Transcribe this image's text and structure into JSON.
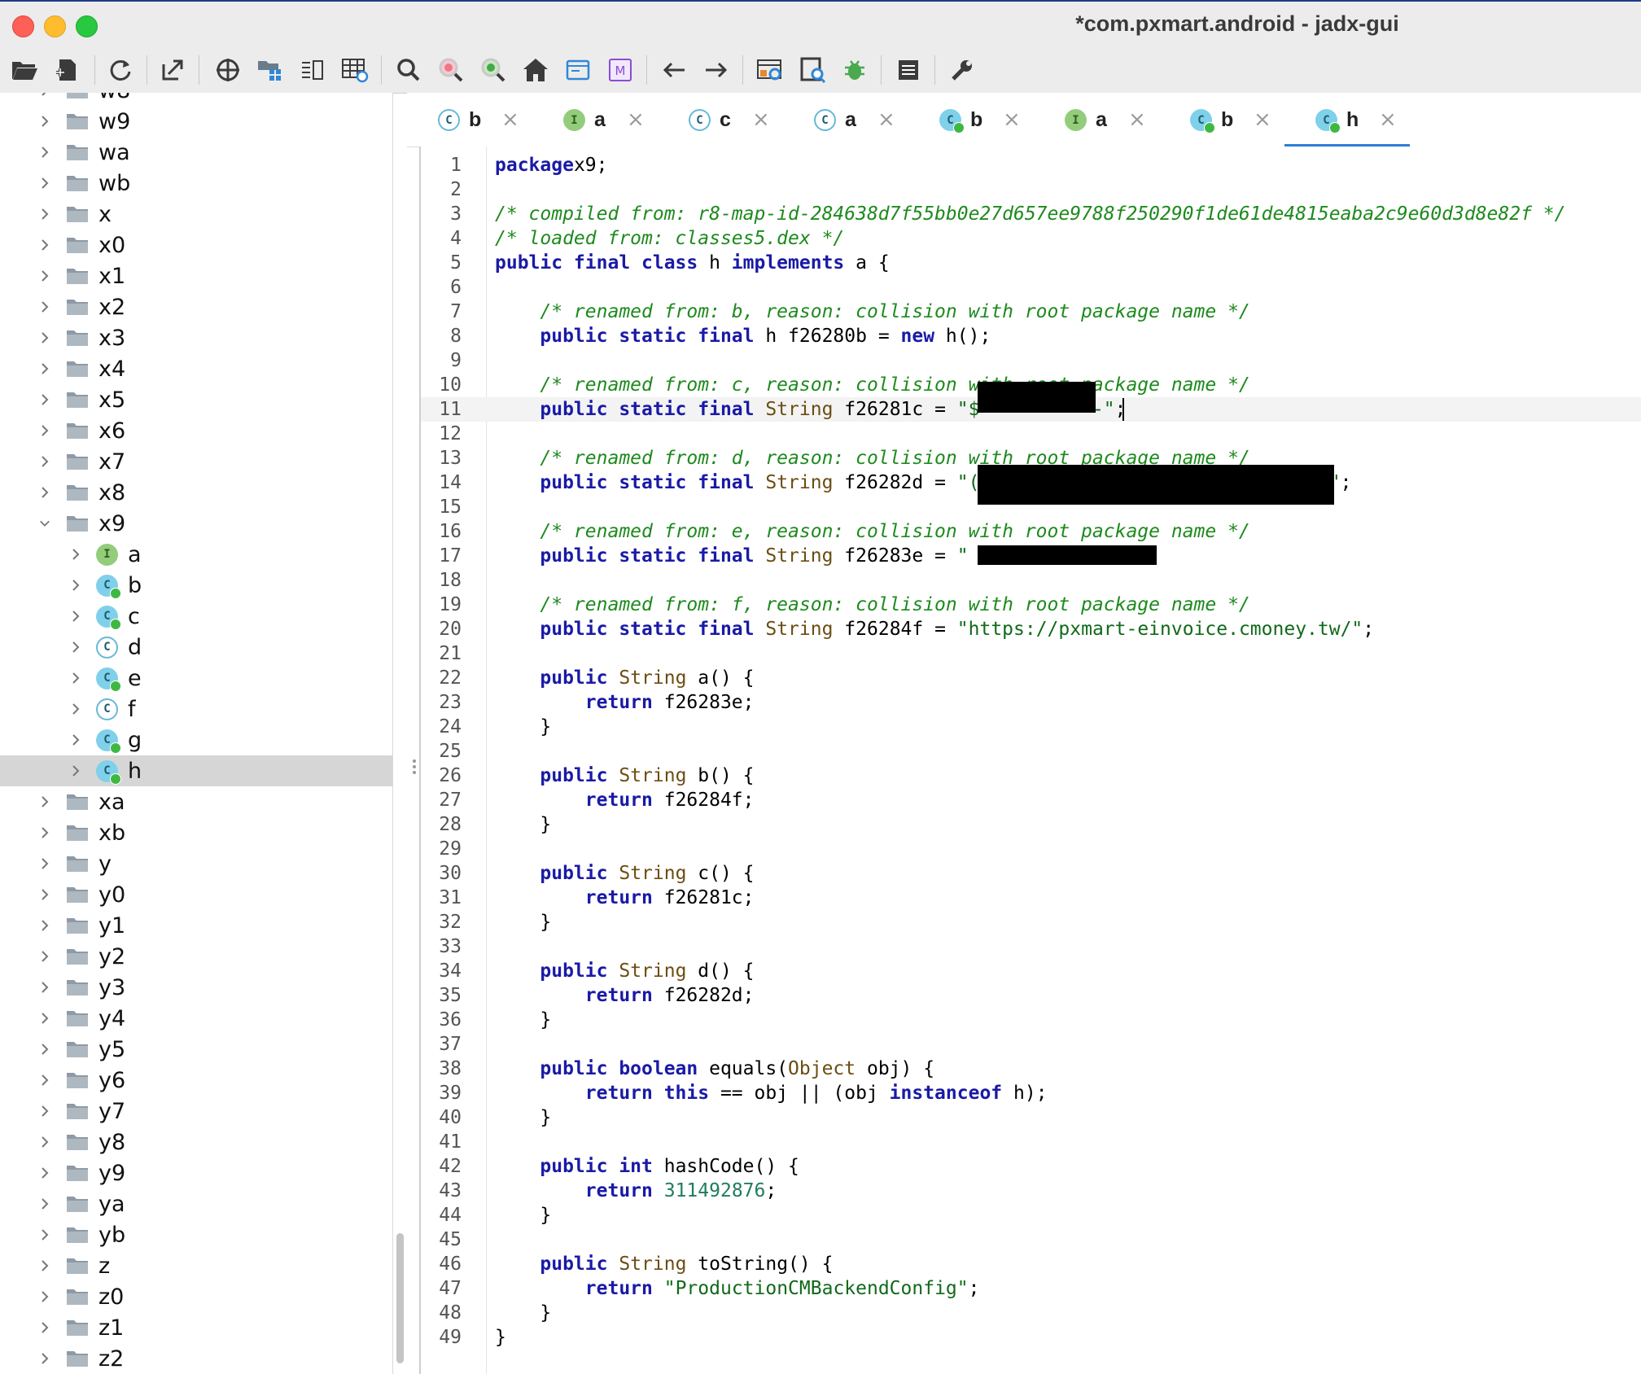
{
  "window": {
    "title": "*com.pxmart.android - jadx-gui"
  },
  "toolbar": {
    "buttons": [
      "open-file-icon",
      "add-files-icon",
      "reload-icon",
      "export-icon",
      "sync-icon",
      "flatten-packages-icon",
      "show-hierarchy-icon",
      "preferences-table-icon",
      "search-icon",
      "text-search-icon",
      "class-search-icon",
      "home-icon",
      "show-log-icon",
      "smali-icon",
      "back-icon",
      "forward-icon",
      "deobfuscation-icon",
      "quark-icon",
      "debug-icon",
      "log-viewer-icon",
      "settings-icon"
    ]
  },
  "tree": {
    "items": [
      {
        "label": "w8",
        "type": "package",
        "expanded": false
      },
      {
        "label": "w9",
        "type": "package",
        "expanded": false
      },
      {
        "label": "wa",
        "type": "package",
        "expanded": false
      },
      {
        "label": "wb",
        "type": "package",
        "expanded": false
      },
      {
        "label": "x",
        "type": "package",
        "expanded": false
      },
      {
        "label": "x0",
        "type": "package",
        "expanded": false
      },
      {
        "label": "x1",
        "type": "package",
        "expanded": false
      },
      {
        "label": "x2",
        "type": "package",
        "expanded": false
      },
      {
        "label": "x3",
        "type": "package",
        "expanded": false
      },
      {
        "label": "x4",
        "type": "package",
        "expanded": false
      },
      {
        "label": "x5",
        "type": "package",
        "expanded": false
      },
      {
        "label": "x6",
        "type": "package",
        "expanded": false
      },
      {
        "label": "x7",
        "type": "package",
        "expanded": false
      },
      {
        "label": "x8",
        "type": "package",
        "expanded": false
      },
      {
        "label": "x9",
        "type": "package",
        "expanded": true
      },
      {
        "label": "a",
        "type": "interface",
        "child": true
      },
      {
        "label": "b",
        "type": "class-public",
        "child": true
      },
      {
        "label": "c",
        "type": "class-public",
        "child": true
      },
      {
        "label": "d",
        "type": "class",
        "child": true
      },
      {
        "label": "e",
        "type": "class-public",
        "child": true
      },
      {
        "label": "f",
        "type": "class",
        "child": true
      },
      {
        "label": "g",
        "type": "class-public",
        "child": true
      },
      {
        "label": "h",
        "type": "class-public",
        "child": true,
        "selected": true
      },
      {
        "label": "xa",
        "type": "package",
        "expanded": false
      },
      {
        "label": "xb",
        "type": "package",
        "expanded": false
      },
      {
        "label": "y",
        "type": "package",
        "expanded": false
      },
      {
        "label": "y0",
        "type": "package",
        "expanded": false
      },
      {
        "label": "y1",
        "type": "package",
        "expanded": false
      },
      {
        "label": "y2",
        "type": "package",
        "expanded": false
      },
      {
        "label": "y3",
        "type": "package",
        "expanded": false
      },
      {
        "label": "y4",
        "type": "package",
        "expanded": false
      },
      {
        "label": "y5",
        "type": "package",
        "expanded": false
      },
      {
        "label": "y6",
        "type": "package",
        "expanded": false
      },
      {
        "label": "y7",
        "type": "package",
        "expanded": false
      },
      {
        "label": "y8",
        "type": "package",
        "expanded": false
      },
      {
        "label": "y9",
        "type": "package",
        "expanded": false
      },
      {
        "label": "ya",
        "type": "package",
        "expanded": false
      },
      {
        "label": "yb",
        "type": "package",
        "expanded": false
      },
      {
        "label": "z",
        "type": "package",
        "expanded": false
      },
      {
        "label": "z0",
        "type": "package",
        "expanded": false
      },
      {
        "label": "z1",
        "type": "package",
        "expanded": false
      },
      {
        "label": "z2",
        "type": "package",
        "expanded": false
      }
    ]
  },
  "tabs": [
    {
      "label": "b",
      "type": "class",
      "close": "×"
    },
    {
      "label": "a",
      "type": "interface",
      "close": "×"
    },
    {
      "label": "c",
      "type": "class",
      "close": "×"
    },
    {
      "label": "a",
      "type": "class",
      "close": "×"
    },
    {
      "label": "b",
      "type": "class-public",
      "close": "×"
    },
    {
      "label": "a",
      "type": "interface",
      "close": "×"
    },
    {
      "label": "b",
      "type": "class-public",
      "close": "×"
    },
    {
      "label": "h",
      "type": "class-public",
      "close": "×",
      "active": true
    }
  ],
  "editor": {
    "current_line": 11,
    "lines": [
      [
        [
          "kw",
          "package"
        ],
        [
          "",
          "x9;"
        ]
      ],
      [],
      [
        [
          "cm",
          "/* compiled from: r8-map-id-284638d7f55bb0e27d657ee9788f250290f1de61de4815eaba2c9e60d3d8e82f */"
        ]
      ],
      [
        [
          "cm",
          "/* loaded from: classes5.dex */"
        ]
      ],
      [
        [
          "kw",
          "public final class"
        ],
        [
          "",
          " h "
        ],
        [
          "kw",
          "implements"
        ],
        [
          "",
          " a {"
        ]
      ],
      [],
      [
        [
          "",
          "    "
        ],
        [
          "cm",
          "/* renamed from: b, reason: collision with root package name */"
        ]
      ],
      [
        [
          "",
          "    "
        ],
        [
          "kw",
          "public static final"
        ],
        [
          "",
          " h f26280b = "
        ],
        [
          "kw",
          "new"
        ],
        [
          "",
          " h();"
        ]
      ],
      [],
      [
        [
          "",
          "    "
        ],
        [
          "cm",
          "/* renamed from: c, reason: collision with root package name */"
        ]
      ],
      [
        [
          "",
          "    "
        ],
        [
          "kw",
          "public static final"
        ],
        [
          "",
          " "
        ],
        [
          "ty",
          "String"
        ],
        [
          "",
          " f26281c = "
        ],
        [
          "st",
          "\"$          -\""
        ],
        [
          "",
          ";"
        ]
      ],
      [],
      [
        [
          "",
          "    "
        ],
        [
          "cm",
          "/* renamed from: d, reason: collision with root package name */"
        ]
      ],
      [
        [
          "",
          "    "
        ],
        [
          "kw",
          "public static final"
        ],
        [
          "",
          " "
        ],
        [
          "ty",
          "String"
        ],
        [
          "",
          " f26282d = "
        ],
        [
          "st",
          "\"(                              4\""
        ],
        [
          "",
          ";"
        ]
      ],
      [],
      [
        [
          "",
          "    "
        ],
        [
          "cm",
          "/* renamed from: e, reason: collision with root package name */"
        ]
      ],
      [
        [
          "",
          "    "
        ],
        [
          "kw",
          "public static final"
        ],
        [
          "",
          " "
        ],
        [
          "ty",
          "String"
        ],
        [
          "",
          " f26283e = "
        ],
        [
          "st",
          "\"               \""
        ],
        [
          "",
          ";"
        ]
      ],
      [],
      [
        [
          "",
          "    "
        ],
        [
          "cm",
          "/* renamed from: f, reason: collision with root package name */"
        ]
      ],
      [
        [
          "",
          "    "
        ],
        [
          "kw",
          "public static final"
        ],
        [
          "",
          " "
        ],
        [
          "ty",
          "String"
        ],
        [
          "",
          " f26284f = "
        ],
        [
          "st",
          "\"https://pxmart-einvoice.cmoney.tw/\""
        ],
        [
          "",
          ";"
        ]
      ],
      [],
      [
        [
          "",
          "    "
        ],
        [
          "kw",
          "public"
        ],
        [
          "",
          " "
        ],
        [
          "ty",
          "String"
        ],
        [
          "",
          " a() {"
        ]
      ],
      [
        [
          "",
          "        "
        ],
        [
          "kw",
          "return"
        ],
        [
          "",
          " f26283e;"
        ]
      ],
      [
        [
          "",
          "    }"
        ]
      ],
      [],
      [
        [
          "",
          "    "
        ],
        [
          "kw",
          "public"
        ],
        [
          "",
          " "
        ],
        [
          "ty",
          "String"
        ],
        [
          "",
          " b() {"
        ]
      ],
      [
        [
          "",
          "        "
        ],
        [
          "kw",
          "return"
        ],
        [
          "",
          " f26284f;"
        ]
      ],
      [
        [
          "",
          "    }"
        ]
      ],
      [],
      [
        [
          "",
          "    "
        ],
        [
          "kw",
          "public"
        ],
        [
          "",
          " "
        ],
        [
          "ty",
          "String"
        ],
        [
          "",
          " c() {"
        ]
      ],
      [
        [
          "",
          "        "
        ],
        [
          "kw",
          "return"
        ],
        [
          "",
          " f26281c;"
        ]
      ],
      [
        [
          "",
          "    }"
        ]
      ],
      [],
      [
        [
          "",
          "    "
        ],
        [
          "kw",
          "public"
        ],
        [
          "",
          " "
        ],
        [
          "ty",
          "String"
        ],
        [
          "",
          " d() {"
        ]
      ],
      [
        [
          "",
          "        "
        ],
        [
          "kw",
          "return"
        ],
        [
          "",
          " f26282d;"
        ]
      ],
      [
        [
          "",
          "    }"
        ]
      ],
      [],
      [
        [
          "",
          "    "
        ],
        [
          "kw",
          "public boolean"
        ],
        [
          "",
          " equals("
        ],
        [
          "ty",
          "Object"
        ],
        [
          "",
          " obj) {"
        ]
      ],
      [
        [
          "",
          "        "
        ],
        [
          "kw",
          "return this"
        ],
        [
          "",
          " == obj || (obj "
        ],
        [
          "kw",
          "instanceof"
        ],
        [
          "",
          " h);"
        ]
      ],
      [
        [
          "",
          "    }"
        ]
      ],
      [],
      [
        [
          "",
          "    "
        ],
        [
          "kw",
          "public int"
        ],
        [
          "",
          " hashCode() {"
        ]
      ],
      [
        [
          "",
          "        "
        ],
        [
          "kw",
          "return"
        ],
        [
          "",
          " "
        ],
        [
          "nu",
          "311492876"
        ],
        [
          "",
          ";"
        ]
      ],
      [
        [
          "",
          "    }"
        ]
      ],
      [],
      [
        [
          "",
          "    "
        ],
        [
          "kw",
          "public"
        ],
        [
          "",
          " "
        ],
        [
          "ty",
          "String"
        ],
        [
          "",
          " toString() {"
        ]
      ],
      [
        [
          "",
          "        "
        ],
        [
          "kw",
          "return"
        ],
        [
          "",
          " "
        ],
        [
          "st",
          "\"ProductionCMBackendConfig\""
        ],
        [
          "",
          ";"
        ]
      ],
      [
        [
          "",
          "    }"
        ]
      ],
      [
        [
          "",
          "}"
        ]
      ]
    ]
  }
}
